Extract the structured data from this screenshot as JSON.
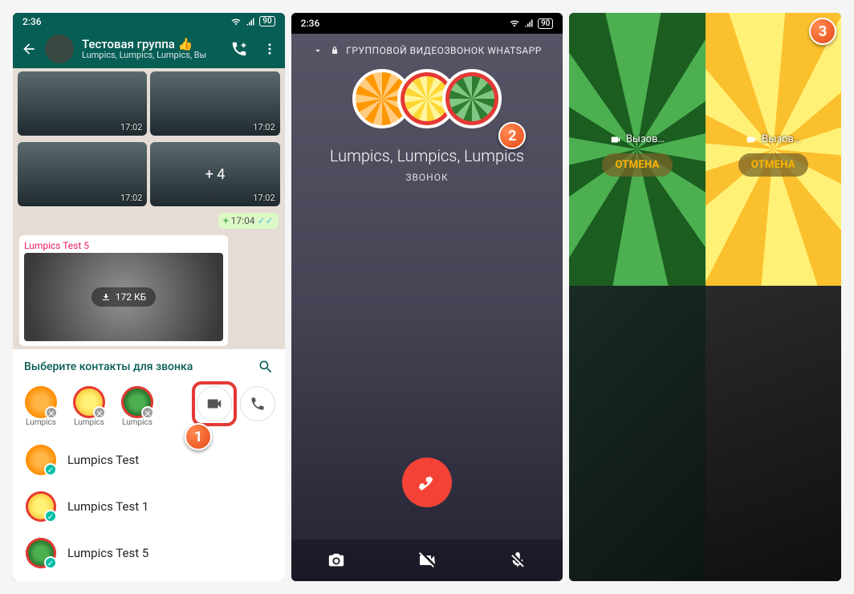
{
  "status": {
    "time": "2:36",
    "battery": "90"
  },
  "screen1": {
    "header": {
      "title": "Тестовая группа 👍",
      "subtitle": "Lumpics, Lumpics, Lumpics, Вы"
    },
    "chat": {
      "thumb_time": "17:02",
      "more_thumbs": "+ 4",
      "status_time": "17:04",
      "incoming_sender": "Lumpics Test 5",
      "download_size": "172 КБ"
    },
    "sheet": {
      "title": "Выберите контакты для звонка",
      "chips": [
        {
          "name": "Lumpics",
          "color": "orange"
        },
        {
          "name": "Lumpics",
          "color": "yellow"
        },
        {
          "name": "Lumpics",
          "color": "green"
        }
      ],
      "contacts": [
        {
          "name": "Lumpics Test",
          "color": "orange"
        },
        {
          "name": "Lumpics Test 1",
          "color": "yellow"
        },
        {
          "name": "Lumpics Test 5",
          "color": "green"
        }
      ]
    }
  },
  "screen2": {
    "call_type": "ГРУППОВОЙ ВИДЕОЗВОНОК WHATSAPP",
    "names": "Lumpics, Lumpics, Lumpics",
    "status": "ЗВОНОК"
  },
  "screen3": {
    "call_status": "Вызов…",
    "cancel": "ОТМЕНА"
  },
  "steps": {
    "s1": "1",
    "s2": "2",
    "s3": "3"
  }
}
